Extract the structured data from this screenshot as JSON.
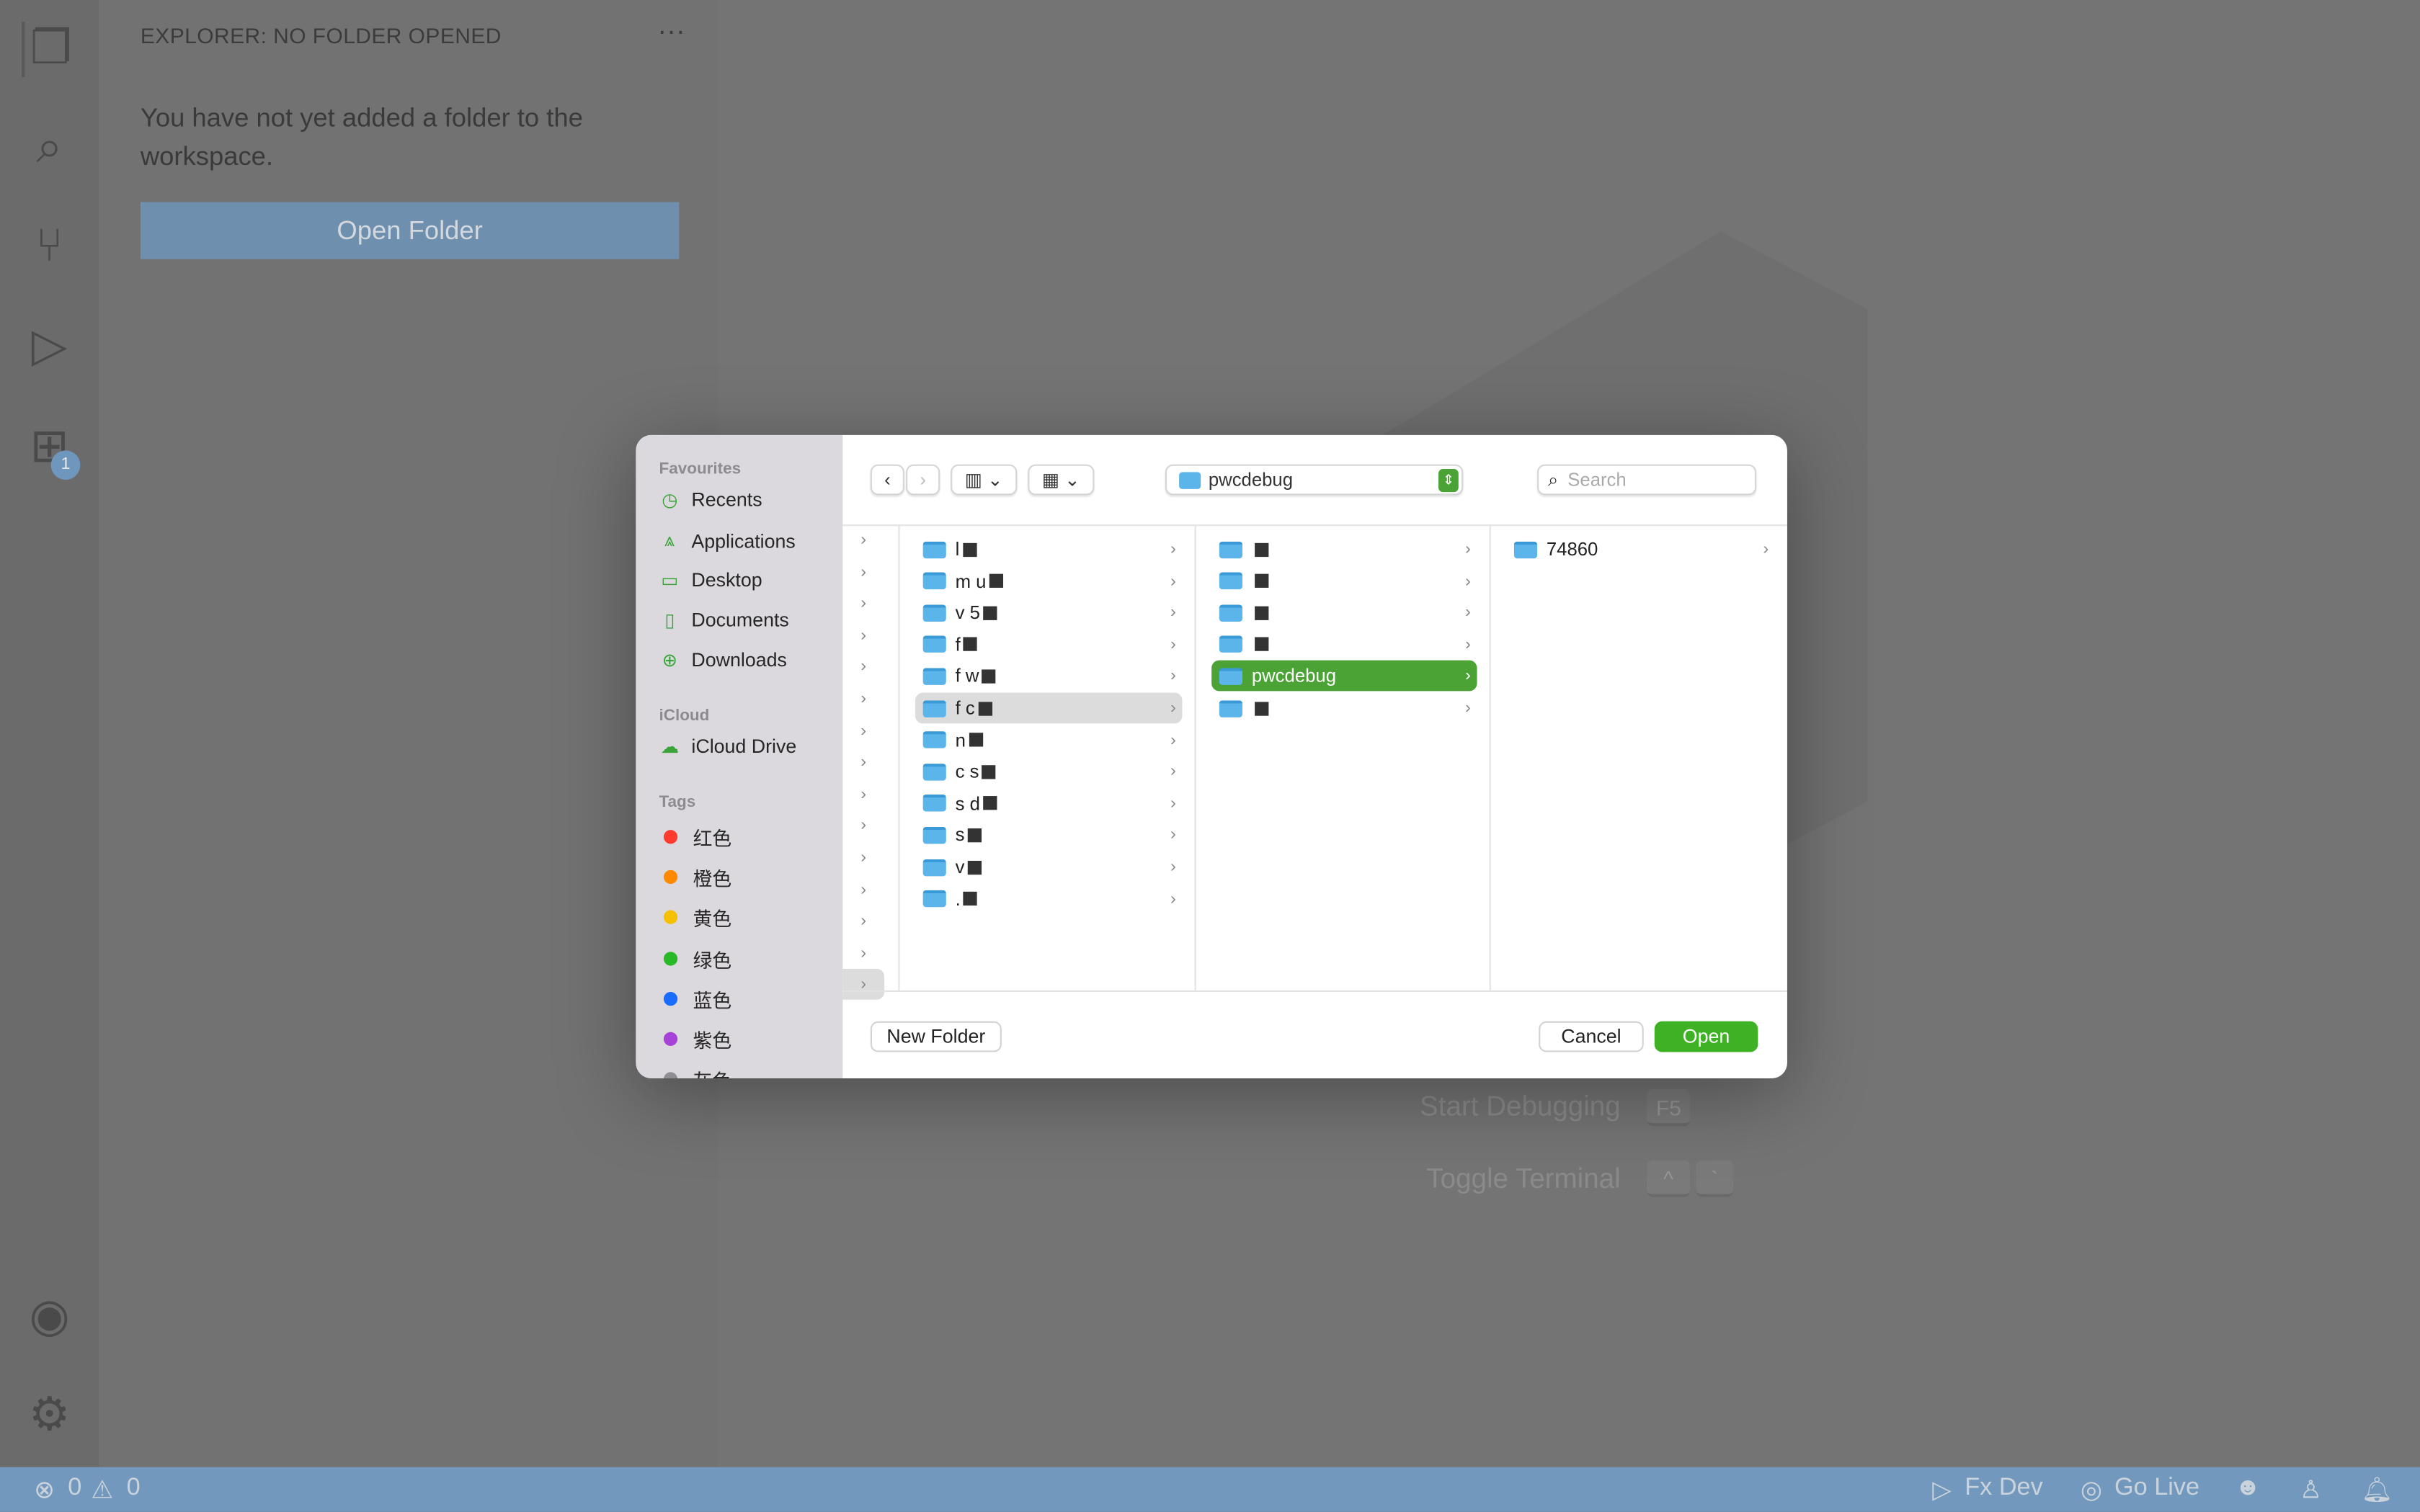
{
  "activity_bar": {
    "extensions_badge": "1",
    "icons": [
      "files-icon",
      "search-icon",
      "source-control-icon",
      "run-debug-icon",
      "extensions-icon",
      "account-icon",
      "gear-icon"
    ]
  },
  "explorer": {
    "title": "EXPLORER: NO FOLDER OPENED",
    "message": "You have not yet added a folder to the workspace.",
    "open_folder": "Open Folder"
  },
  "editor": {
    "hints": [
      {
        "label": "Start Debugging",
        "keys": [
          "F5"
        ]
      },
      {
        "label": "Toggle Terminal",
        "keys": [
          "^",
          "`"
        ]
      }
    ]
  },
  "status_bar": {
    "errors": "0",
    "warnings": "0",
    "fx_dev": "Fx Dev",
    "go_live": "Go Live",
    "color": "#7299bd"
  },
  "dialog": {
    "sidebar": {
      "favourites_header": "Favourites",
      "favourites": [
        "Recents",
        "Applications",
        "Desktop",
        "Documents",
        "Downloads"
      ],
      "icloud_header": "iCloud",
      "icloud": [
        "iCloud Drive"
      ],
      "tags_header": "Tags",
      "tags": [
        {
          "label": "红色",
          "color": "#ff3b30"
        },
        {
          "label": "橙色",
          "color": "#ff8a00"
        },
        {
          "label": "黄色",
          "color": "#f5c000"
        },
        {
          "label": "绿色",
          "color": "#28b828"
        },
        {
          "label": "蓝色",
          "color": "#1a6cff"
        },
        {
          "label": "紫色",
          "color": "#a742d8"
        },
        {
          "label": "灰色",
          "color": "#8e8e93"
        }
      ]
    },
    "path": "pwcdebug",
    "search_placeholder": "Search",
    "column1": [
      "l",
      "m u",
      "v 5",
      "f",
      "f w",
      "f c",
      "n",
      "c s",
      "s d",
      "s",
      "v",
      "."
    ],
    "column2": [
      "",
      "",
      "",
      "",
      "pwcdebug",
      ""
    ],
    "column3": [
      "74860"
    ],
    "new_folder": "New Folder",
    "cancel": "Cancel",
    "open": "Open",
    "accent": "#4aa334"
  }
}
